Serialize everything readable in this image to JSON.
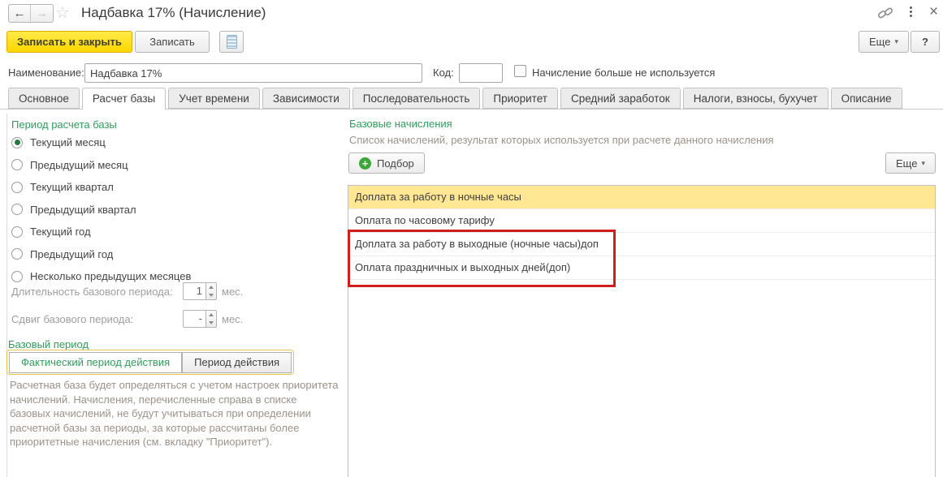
{
  "colors": {
    "accent_green": "#2e9e5b",
    "selection_yellow": "#ffe794",
    "primary_button_yellow": "#fcd600",
    "annotation_red": "#d21d1d"
  },
  "titlebar": {
    "title": "Надбавка 17% (Начисление)",
    "back": "←",
    "forward": "→",
    "star": "☆",
    "close": "×"
  },
  "toolbar": {
    "save_close_label": "Записать и закрыть",
    "save_label": "Записать",
    "more_label": "Еще",
    "more_arrow": "▾",
    "help_label": "?"
  },
  "form": {
    "name_label": "Наименование:",
    "name_value": "Надбавка 17%",
    "code_label": "Код:",
    "code_value": "",
    "unused_label": "Начисление больше не используется",
    "unused_checked": false
  },
  "tabs": [
    {
      "label": "Основное"
    },
    {
      "label": "Расчет базы",
      "active": true
    },
    {
      "label": "Учет времени"
    },
    {
      "label": "Зависимости"
    },
    {
      "label": "Последовательность"
    },
    {
      "label": "Приоритет"
    },
    {
      "label": "Средний заработок"
    },
    {
      "label": "Налоги, взносы, бухучет"
    },
    {
      "label": "Описание"
    }
  ],
  "left_panel": {
    "period_header": "Период расчета базы",
    "radios": [
      {
        "label": "Текущий месяц",
        "selected": true
      },
      {
        "label": "Предыдущий месяц"
      },
      {
        "label": "Текущий квартал"
      },
      {
        "label": "Предыдущий квартал"
      },
      {
        "label": "Текущий год"
      },
      {
        "label": "Предыдущий год"
      },
      {
        "label": "Несколько предыдущих месяцев"
      }
    ],
    "duration_label": "Длительность базового периода:",
    "duration_value": "1",
    "duration_unit": "мес.",
    "shift_label": "Сдвиг базового периода:",
    "shift_value": "-",
    "shift_unit": "мес.",
    "base_period_header": "Базовый период",
    "toggle": [
      {
        "label": "Фактический период действия",
        "selected": true
      },
      {
        "label": "Период действия"
      }
    ],
    "note": "Расчетная база будет определяться с учетом настроек приоритета начислений. Начисления, перечисленные справа в списке базовых начислений, не будут учитываться при определении расчетной базы за периоды, за которые рассчитаны более приоритетные начисления (см. вкладку \"Приоритет\")."
  },
  "right_panel": {
    "header": "Базовые начисления",
    "subtitle": "Список начислений, результат которых используется при расчете данного начисления",
    "pick_label": "Подбор",
    "pick_plus": "+",
    "more_label": "Еще",
    "more_arrow": "▾",
    "rows": [
      {
        "label": "Доплата за работу в ночные часы",
        "selected": true
      },
      {
        "label": "Оплата по часовому тарифу"
      },
      {
        "label": "Доплата за работу в выходные (ночные часы)доп"
      },
      {
        "label": "Оплата праздничных и выходных дней(доп)"
      }
    ]
  }
}
